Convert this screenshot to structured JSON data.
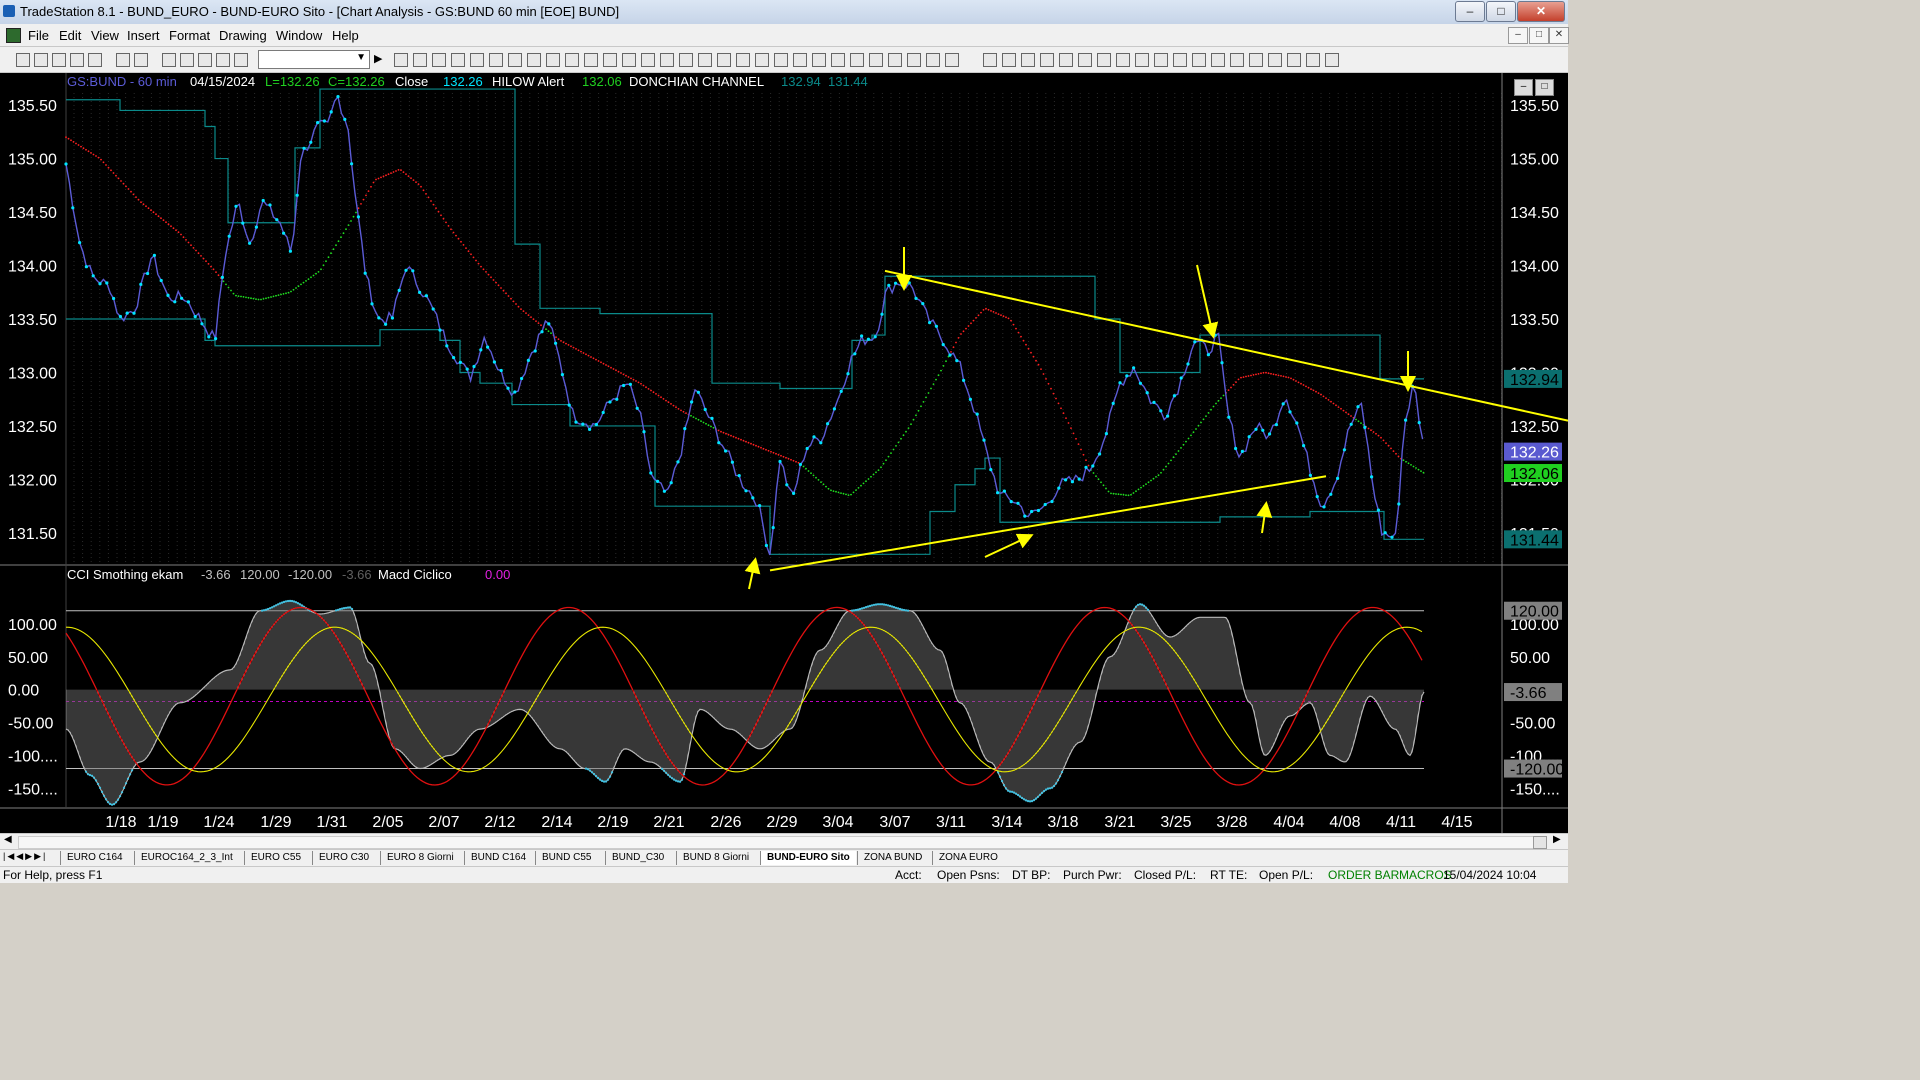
{
  "window": {
    "title": "TradeStation 8.1 - BUND_EURO - BUND-EURO Sito - [Chart Analysis - GS:BUND  60 min  [EOE] BUND]"
  },
  "menu": [
    "File",
    "Edit",
    "View",
    "Insert",
    "Format",
    "Drawing",
    "Window",
    "Help"
  ],
  "colors": {
    "background": "#000000",
    "price": "#5b5bd6",
    "points": "#00e5ff",
    "channel": "#0b8a8a",
    "avg_red": "#ff2020",
    "avg_green": "#20e020",
    "trendline": "#ffff00",
    "cci": "#40c0e0",
    "highlight_label": "#0b6f6f"
  },
  "legend": {
    "symbol": "GS:BUND - 60 min",
    "date": "04/15/2024",
    "low": "L=132.26",
    "close_val": "C=132.26",
    "close_label": "Close",
    "close_num": "132.26",
    "hilow": "HILOW Alert",
    "hilow_val": "132.06",
    "donchian": "DONCHIAN CHANNEL",
    "don_hi": "132.94",
    "don_lo": "131.44"
  },
  "sub_legend": {
    "name": "CCI Smothing ekam",
    "v1": "-3.66",
    "v2": "120.00",
    "v3": "-120.00",
    "v4": "-3.66",
    "macd": "Macd Ciclico",
    "macd_val": "0.00"
  },
  "price_axis": [
    "135.50",
    "135.00",
    "134.50",
    "134.00",
    "133.50",
    "133.00",
    "132.50",
    "132.00",
    "131.50"
  ],
  "price_markers": [
    {
      "text": "132.94",
      "value": 132.94,
      "bg": "#0b6f6f",
      "fg": "#000000"
    },
    {
      "text": "132.26",
      "value": 132.26,
      "bg": "#5a5ad0",
      "fg": "#ffffff"
    },
    {
      "text": "132.06",
      "value": 132.06,
      "bg": "#20d020",
      "fg": "#000000"
    },
    {
      "text": "131.44",
      "value": 131.44,
      "bg": "#0b6f6f",
      "fg": "#000000"
    }
  ],
  "osc_axis": [
    "100.00",
    "50.00",
    "0.00",
    "-50.00",
    "-100....",
    "-150...."
  ],
  "osc_markers": [
    {
      "text": "120.00",
      "value": 120
    },
    {
      "text": "-3.66",
      "value": -3.66
    },
    {
      "text": "-120.00",
      "value": -120
    }
  ],
  "date_axis": [
    "1/18",
    "1/19",
    "1/24",
    "1/29",
    "1/31",
    "2/05",
    "2/07",
    "2/12",
    "2/14",
    "2/19",
    "2/21",
    "2/26",
    "2/29",
    "3/04",
    "3/07",
    "3/11",
    "3/14",
    "3/18",
    "3/21",
    "3/25",
    "3/28",
    "4/04",
    "4/08",
    "4/11",
    "4/15"
  ],
  "chart_data": {
    "type": "line",
    "title": "GS:BUND - 60 min",
    "x": [
      "1/18",
      "1/24",
      "1/31",
      "2/05",
      "2/12",
      "2/19",
      "2/26",
      "2/29",
      "3/07",
      "3/14",
      "3/21",
      "3/25",
      "4/04",
      "4/08",
      "4/11",
      "4/15"
    ],
    "series": [
      {
        "name": "Close",
        "values": [
          134.9,
          133.4,
          135.5,
          133.5,
          132.8,
          132.4,
          131.9,
          131.3,
          133.9,
          131.6,
          133.0,
          133.3,
          132.6,
          131.7,
          132.9,
          132.26
        ]
      },
      {
        "name": "HILOW Alert",
        "values": [
          132.06
        ]
      },
      {
        "name": "DONCHIAN CHANNEL",
        "values": [
          132.94,
          131.44
        ]
      }
    ],
    "ylim": [
      131.2,
      135.8
    ],
    "osc_ylim": [
      -180,
      150
    ],
    "grid": true
  },
  "window_tabs": [
    "EURO C164",
    "EUROC164_2_3_Int",
    "EURO C55",
    "EURO C30",
    "EURO 8 Giorni",
    "BUND C164",
    "BUND C55",
    "BUND_C30",
    "BUND 8 Giorni",
    "BUND-EURO Sito",
    "ZONA BUND",
    "ZONA EURO"
  ],
  "active_tab": "BUND-EURO Sito",
  "status": {
    "help": "For Help, press F1",
    "acct": "Acct:",
    "open_psns": "Open Psns:",
    "dt_bp": "DT BP:",
    "purch_pwr": "Purch Pwr:",
    "closed_pl": "Closed P/L:",
    "rt_te": "RT TE:",
    "open_pl": "Open P/L:",
    "order_bar": "ORDER BAR",
    "macros": "MACROS",
    "datetime": "15/04/2024 10:04"
  }
}
